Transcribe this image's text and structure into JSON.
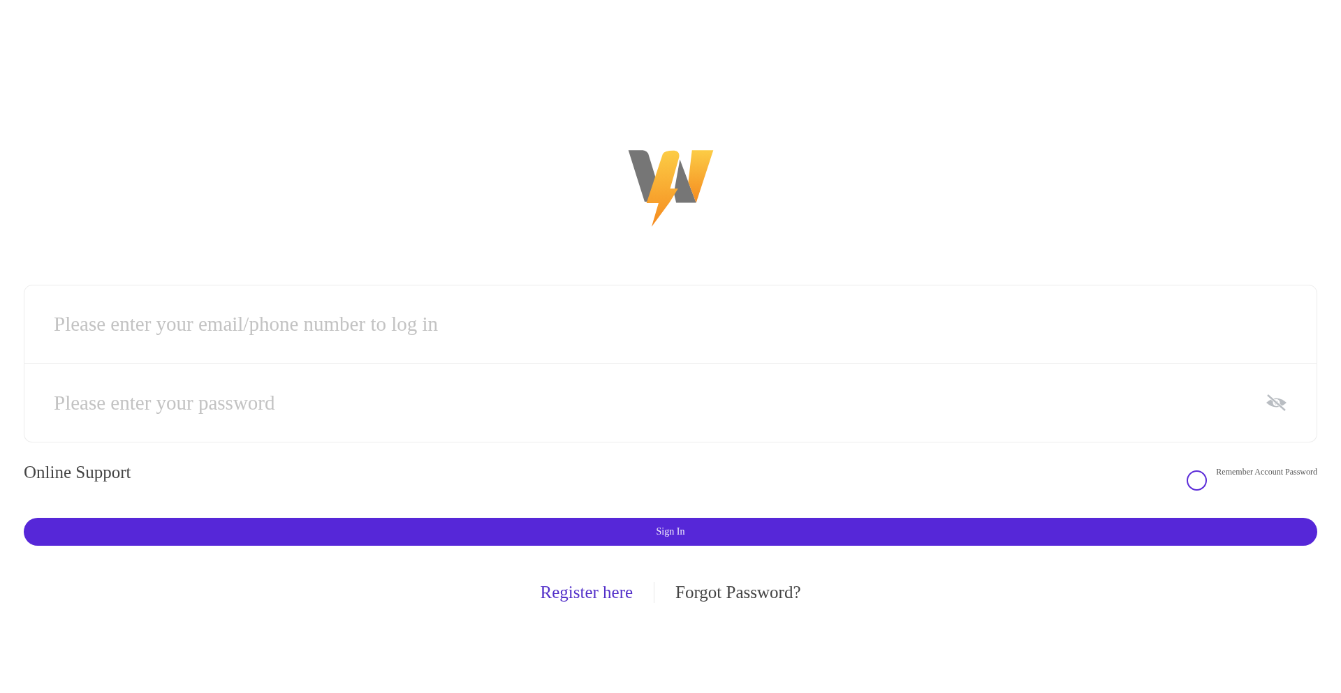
{
  "login_form": {
    "fields": [
      {
        "kind": "text",
        "placeholder": "Please enter your email/phone number to log in"
      },
      {
        "kind": "password",
        "placeholder": "Please enter your password",
        "password_visible": false
      }
    ]
  },
  "online_support": {
    "label": "Online Support"
  },
  "remember": {
    "label": "Remember Account Password",
    "checked": false
  },
  "sign_in_button": {
    "label": "Sign In"
  },
  "links": [
    {
      "label": "Register here",
      "kind": "primary"
    },
    {
      "label": "Forgot Password?",
      "kind": "plain"
    }
  ]
}
